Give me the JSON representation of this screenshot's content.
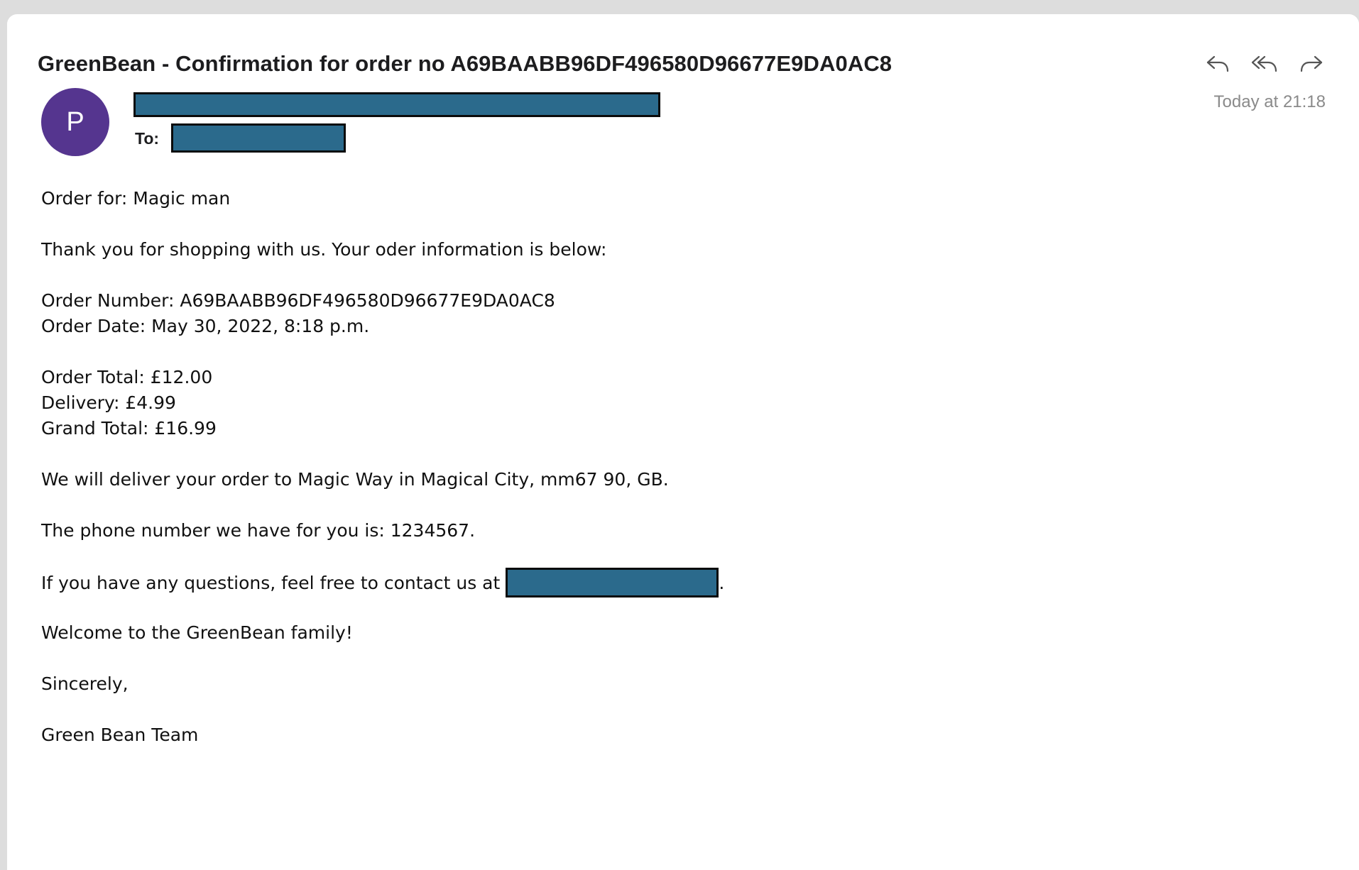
{
  "message": {
    "subject": "GreenBean - Confirmation for order no A69BAABB96DF496580D96677E9DA0AC8",
    "avatar_initial": "P",
    "to_label": "To:",
    "timestamp": "Today at 21:18"
  },
  "toolbar": {
    "icons": [
      "reply-icon",
      "reply-all-icon",
      "forward-icon"
    ]
  },
  "body": {
    "order_for": "Order for: Magic man",
    "thanks": "Thank you for shopping with us. Your oder information is below:",
    "order_number": "Order Number: A69BAABB96DF496580D96677E9DA0AC8",
    "order_date": "Order Date: May 30, 2022, 8:18 p.m.",
    "order_total": "Order Total: £12.00",
    "delivery": "Delivery: £4.99",
    "grand_total": "Grand Total: £16.99",
    "delivery_address": "We will deliver your order to Magic Way in Magical City, mm67 90, GB.",
    "phone": "The phone number we have for you is: 1234567.",
    "questions": "If you have any questions, feel free to contact us at",
    "questions_end": ".",
    "welcome": "Welcome to the GreenBean family!",
    "closing": "Sincerely,",
    "signature": "Green Bean Team"
  },
  "colors": {
    "avatar": "#55358f",
    "redaction": "#2b6a8c"
  }
}
